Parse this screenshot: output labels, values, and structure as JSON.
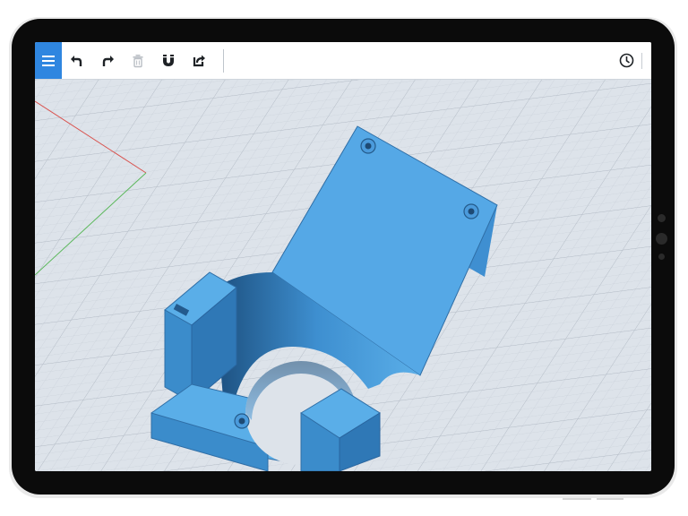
{
  "app": {
    "toolbar": {
      "menu_icon": "hamburger-menu-icon",
      "buttons": [
        {
          "name": "undo",
          "icon": "undo-arrow-icon"
        },
        {
          "name": "redo",
          "icon": "redo-arrow-icon"
        },
        {
          "name": "delete",
          "icon": "trash-icon",
          "state": "disabled"
        },
        {
          "name": "snap",
          "icon": "magnet-icon"
        },
        {
          "name": "export",
          "icon": "share-export-icon"
        }
      ],
      "history_icon": "clock-history-icon"
    },
    "colors": {
      "accent": "#2f86e0",
      "model": "#5aaee8",
      "canvas": "#dde3ea",
      "grid": "#c3cad3",
      "x_axis": "#d9534f",
      "y_axis": "#5cb85c"
    },
    "viewport": {
      "object": "3d-printed-bracket-model",
      "grid": true
    }
  }
}
